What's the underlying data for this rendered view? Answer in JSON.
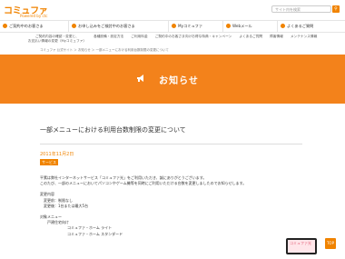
{
  "brand": {
    "name": "コミュファ",
    "sub": "Powered by ctc"
  },
  "search": {
    "placeholder": "サイト内を検索"
  },
  "main_nav": [
    {
      "label": "ご契約中のお客さま"
    },
    {
      "label": "お申し込みをご検討中のお客さま"
    },
    {
      "label": "Myコミュファ"
    },
    {
      "label": "Webメール"
    },
    {
      "label": "よくあるご質問"
    }
  ],
  "sub_nav": [
    {
      "line1": "ご契約内容の確認・変更と、",
      "line2": "お支払い情報の変更（Myコミュファ）"
    },
    {
      "line1": "各種設備・設定方法",
      "line2": ""
    },
    {
      "line1": "ご利用料金",
      "line2": ""
    },
    {
      "line1": "ご契約中のお客さま向けお得な特典・キャンペーン",
      "line2": ""
    },
    {
      "line1": "よくあるご質問",
      "line2": ""
    },
    {
      "line1": "障害情報",
      "line2": ""
    },
    {
      "line1": "メンテナンス情報",
      "line2": ""
    }
  ],
  "breadcrumb": "コミュファ 公式サイト ＞ お知らせ ＞ 一部メニューにおける利用台数制限の変更について",
  "banner": {
    "title": "お知らせ",
    "accent": "#f3821b"
  },
  "article": {
    "title": "一部メニューにおける利用台数制限の変更について",
    "date": "2011年11月2日",
    "tag": "サービス",
    "paragraphs": [
      "平素は弊社インターネットサービス「コミュファ光」をご利用いただき、誠にありがとうございます。",
      "このたび、一部のメニューにおいてパソコンやゲーム機等を同時にご利用いただける台数を変更しましたのでお知らせします。"
    ],
    "change_heading": "変更内容",
    "before": "変更前：制限なし",
    "after": "変更後：1台または最大5台",
    "target_heading": "対象メニュー",
    "target_group": "戸建住宅向け",
    "menus": [
      "コミュファ・ホーム ライト",
      "コミュファ・ホーム スタンダード"
    ]
  },
  "floating": {
    "label": "コミュファ光",
    "top": "TOP"
  }
}
